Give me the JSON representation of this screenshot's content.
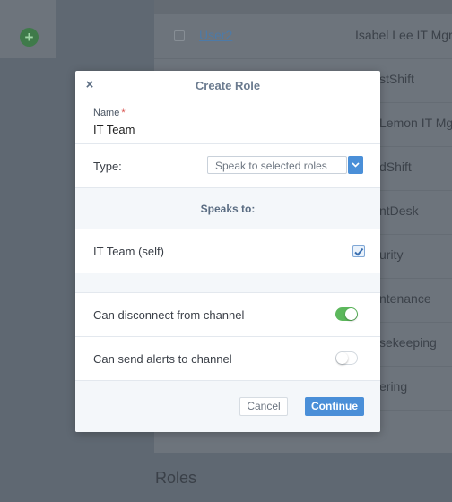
{
  "background": {
    "add_icon": "plus-circle-icon",
    "rows": [
      {
        "user": "User2",
        "name": "Isabel Lee",
        "role": "IT Mgr"
      },
      {
        "role": "stShift"
      },
      {
        "role": "Lemon IT Mgr"
      },
      {
        "role": "dShift"
      },
      {
        "role": "ntDesk"
      },
      {
        "role": "urity"
      },
      {
        "role": "ntenance"
      },
      {
        "role": "sekeeping"
      },
      {
        "role": "ering"
      }
    ],
    "section_title": "Roles"
  },
  "modal": {
    "close_icon": "close-icon",
    "close_glyph": "×",
    "title": "Create Role",
    "name_label": "Name",
    "required_marker": "*",
    "name_value": "IT Team",
    "type_label": "Type:",
    "type_value": "Speak to selected roles",
    "speaks_to_title": "Speaks to:",
    "self_role_label": "IT Team (self)",
    "self_role_checked": true,
    "options": [
      {
        "label": "Can disconnect from channel",
        "enabled": true
      },
      {
        "label": "Can send alerts to channel",
        "enabled": false
      }
    ],
    "cancel_label": "Cancel",
    "continue_label": "Continue"
  },
  "colors": {
    "accent": "#4a8fd8",
    "toggle_on": "#5cb85c",
    "overlay": "#5f6872"
  }
}
